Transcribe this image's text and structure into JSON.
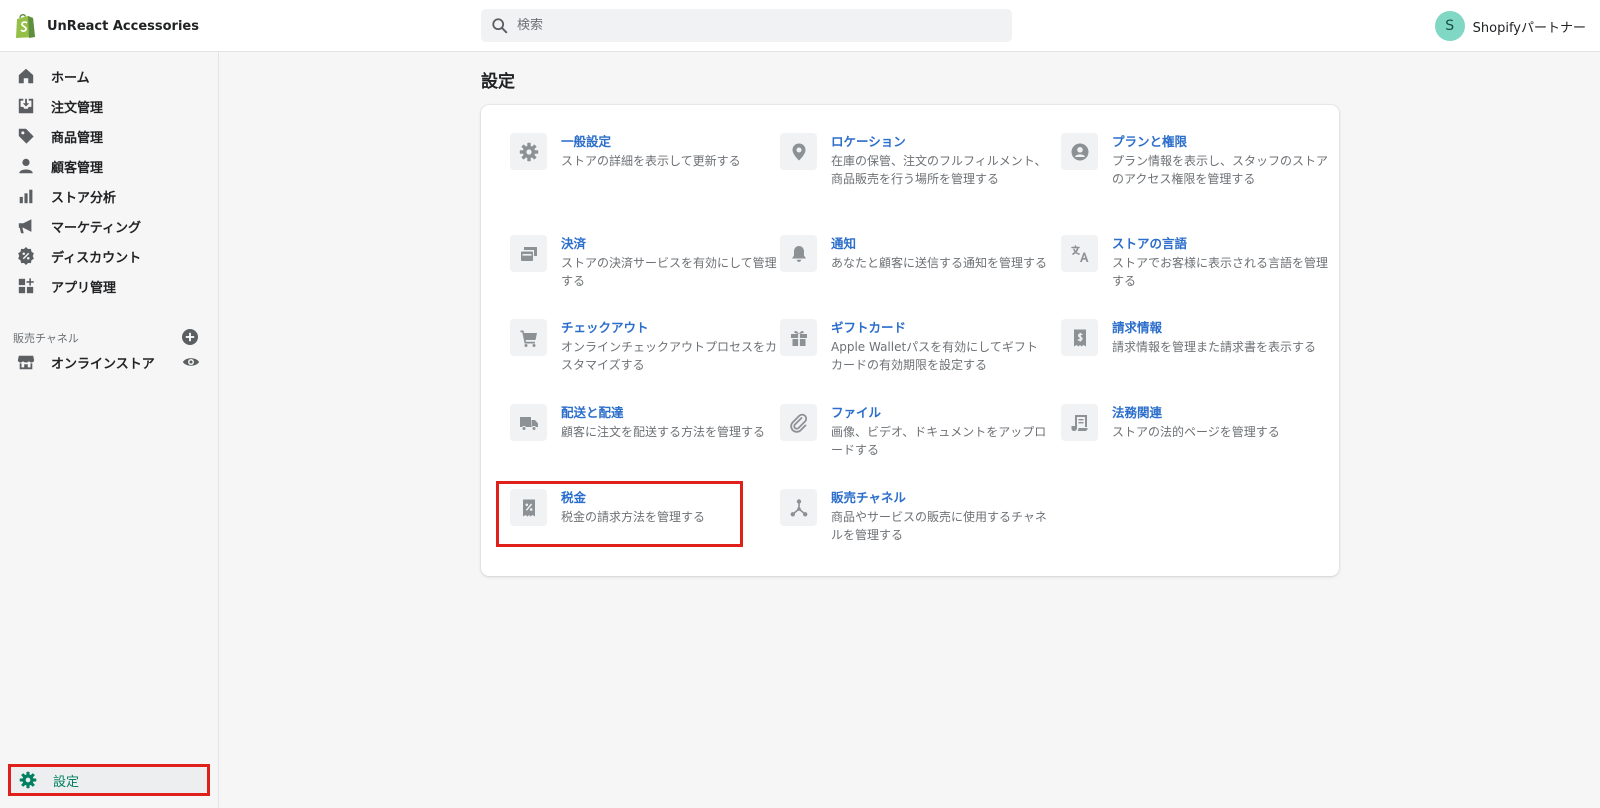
{
  "topbar": {
    "store_name": "UnReact Accessories",
    "search_placeholder": "検索",
    "avatar_initial": "S",
    "user_name": "Shopifyパートナー"
  },
  "sidebar": {
    "items": [
      {
        "label": "ホーム",
        "icon": "home-icon"
      },
      {
        "label": "注文管理",
        "icon": "orders-icon"
      },
      {
        "label": "商品管理",
        "icon": "tag-icon"
      },
      {
        "label": "顧客管理",
        "icon": "customer-icon"
      },
      {
        "label": "ストア分析",
        "icon": "analytics-icon"
      },
      {
        "label": "マーケティング",
        "icon": "megaphone-icon"
      },
      {
        "label": "ディスカウント",
        "icon": "discount-icon"
      },
      {
        "label": "アプリ管理",
        "icon": "apps-icon"
      }
    ],
    "sales_channels_title": "販売チャネル",
    "online_store": "オンラインストア",
    "settings_label": "設定"
  },
  "main": {
    "page_title": "設定",
    "tiles": [
      {
        "title": "一般設定",
        "desc": "ストアの詳細を表示して更新する",
        "icon": "gear-icon"
      },
      {
        "title": "ロケーション",
        "desc": "在庫の保管、注文のフルフィルメント、商品販売を行う場所を管理する",
        "icon": "location-pin-icon"
      },
      {
        "title": "プランと権限",
        "desc": "プラン情報を表示し、スタッフのストアのアクセス権限を管理する",
        "icon": "profile-icon"
      },
      {
        "title": "決済",
        "desc": "ストアの決済サービスを有効にして管理する",
        "icon": "payment-card-icon"
      },
      {
        "title": "通知",
        "desc": "あなたと顧客に送信する通知を管理する",
        "icon": "bell-icon"
      },
      {
        "title": "ストアの言語",
        "desc": "ストアでお客様に表示される言語を管理する",
        "icon": "translate-icon"
      },
      {
        "title": "チェックアウト",
        "desc": "オンラインチェックアウトプロセスをカスタマイズする",
        "icon": "cart-icon"
      },
      {
        "title": "ギフトカード",
        "desc": "Apple Walletパスを有効にしてギフトカードの有効期限を設定する",
        "icon": "gift-icon"
      },
      {
        "title": "請求情報",
        "desc": "請求情報を管理また請求書を表示する",
        "icon": "receipt-dollar-icon"
      },
      {
        "title": "配送と配達",
        "desc": "顧客に注文を配送する方法を管理する",
        "icon": "truck-icon"
      },
      {
        "title": "ファイル",
        "desc": "画像、ビデオ、ドキュメントをアップロードする",
        "icon": "paperclip-icon"
      },
      {
        "title": "法務関連",
        "desc": "ストアの法的ページを管理する",
        "icon": "legal-scroll-icon"
      },
      {
        "title": "税金",
        "desc": "税金の請求方法を管理する",
        "icon": "tax-receipt-icon"
      },
      {
        "title": "販売チャネル",
        "desc": "商品やサービスの販売に使用するチャネルを管理する",
        "icon": "channels-icon"
      }
    ]
  },
  "colors": {
    "link": "#2c6ecb",
    "brand_green": "#008060",
    "highlight_red": "#e0201b",
    "icon_gray": "#8c9196"
  }
}
